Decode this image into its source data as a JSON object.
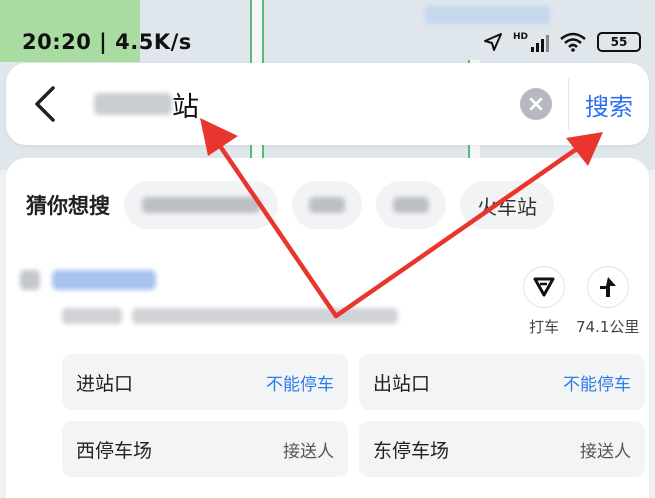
{
  "status": {
    "time_speed": "20:20 | 4.5K/s",
    "network_badge": "HD",
    "battery": "55"
  },
  "search": {
    "query_suffix": "站",
    "search_label": "搜索"
  },
  "guess": {
    "label": "猜你想搜",
    "last_chip": "火车站"
  },
  "actions": {
    "taxi_label": "打车",
    "distance_label": "74.1公里"
  },
  "tiles": [
    {
      "name": "进站口",
      "tag": "不能停车"
    },
    {
      "name": "出站口",
      "tag": "不能停车"
    },
    {
      "name": "西停车场",
      "tag": "接送人"
    },
    {
      "name": "东停车场",
      "tag": "接送人"
    }
  ],
  "colors": {
    "accent_blue": "#2b6ff6",
    "annotation_red": "#e8362f"
  }
}
